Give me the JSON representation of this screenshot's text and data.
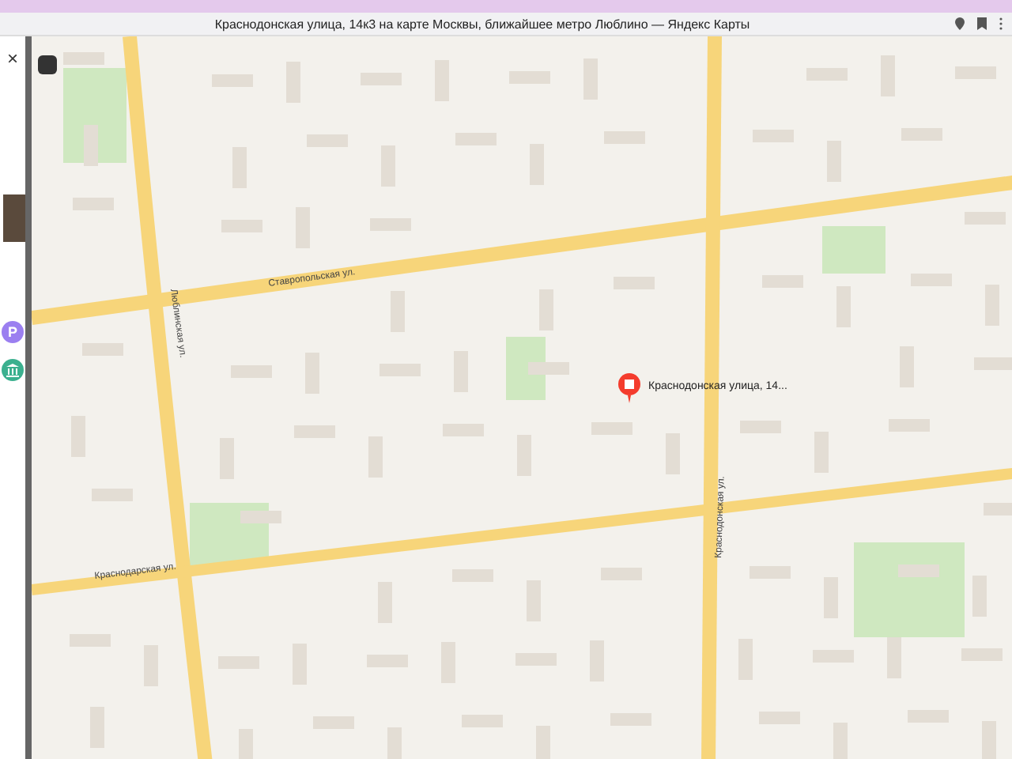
{
  "window": {
    "title": "Краснодонская улица, 14к3 на карте Москвы, ближайшее метро Люблино — Яндекс Карты"
  },
  "sidebar": {
    "close": "×",
    "parking_glyph": "P"
  },
  "map": {
    "streets": [
      {
        "label": "Ставропольская ул."
      },
      {
        "label": "Люблинская ул."
      },
      {
        "label": "Краснодарская ул."
      },
      {
        "label": "Краснодонская ул."
      }
    ],
    "pin": {
      "label": "Краснодонская улица, 14..."
    }
  }
}
